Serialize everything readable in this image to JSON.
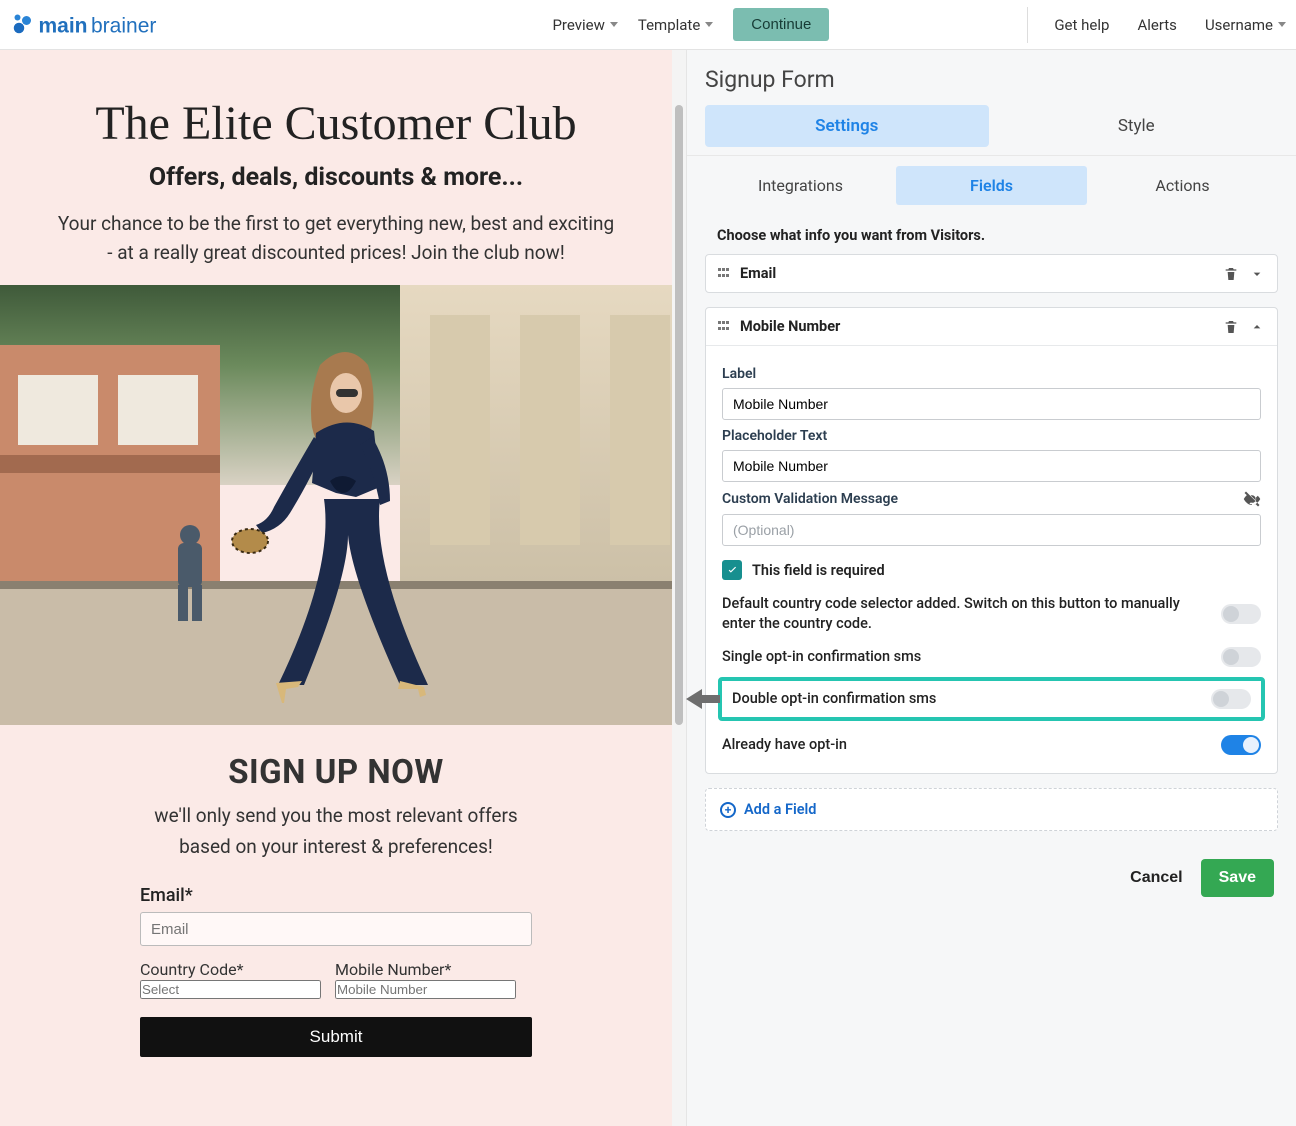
{
  "brand": "mainbrainer",
  "topbar": {
    "preview": "Preview",
    "template": "Template",
    "continue": "Continue",
    "gethelp": "Get help",
    "alerts": "Alerts",
    "username": "Username"
  },
  "preview": {
    "title": "The Elite Customer Club",
    "subtitle": "Offers, deals, discounts & more...",
    "lead1": "Your chance to be the first to get everything new, best and exciting",
    "lead2": "- at a really great discounted prices! Join the club now!",
    "signup_title": "SIGN UP NOW",
    "signup_sub1": "we'll only send you the most relevant offers",
    "signup_sub2": "based on your interest & preferences!",
    "email_label": "Email*",
    "email_ph": "Email",
    "cc_label": "Country Code*",
    "cc_ph": "Select",
    "mobile_label": "Mobile Number*",
    "mobile_ph": "Mobile Number",
    "submit": "Submit"
  },
  "panel": {
    "title": "Signup Form",
    "tab_settings": "Settings",
    "tab_style": "Style",
    "tab_integrations": "Integrations",
    "tab_fields": "Fields",
    "tab_actions": "Actions",
    "intro": "Choose what info you want from Visitors.",
    "field_email": "Email",
    "field_mobile": "Mobile Number",
    "label_label": "Label",
    "label_value": "Mobile Number",
    "placeholder_label": "Placeholder Text",
    "placeholder_value": "Mobile Number",
    "cvm_label": "Custom Validation Message",
    "cvm_ph": "(Optional)",
    "required": "This field is required",
    "opt_country": "Default country code selector added. Switch on this button to manually enter the country code.",
    "opt_single": "Single opt-in confirmation sms",
    "opt_double": "Double opt-in confirmation sms",
    "opt_already": "Already have opt-in",
    "add_field": "Add a Field",
    "cancel": "Cancel",
    "save": "Save"
  }
}
